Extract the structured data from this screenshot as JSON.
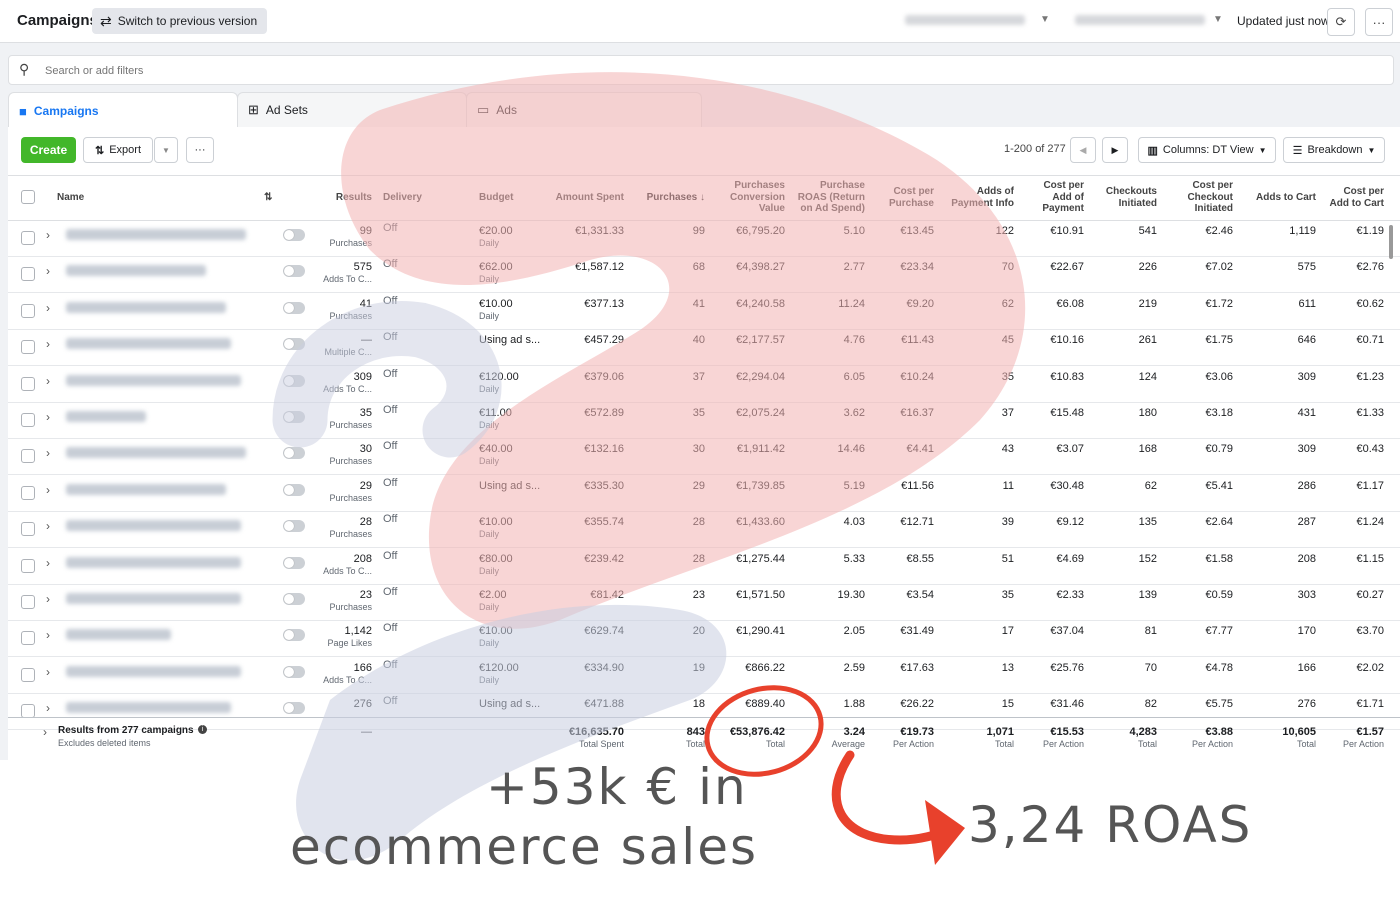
{
  "topbar": {
    "title": "Campaigns",
    "switch_label": "Switch to previous version",
    "updated": "Updated just now"
  },
  "search": {
    "placeholder": "Search or add filters"
  },
  "tabs": [
    {
      "label": "Campaigns"
    },
    {
      "label": "Ad Sets"
    },
    {
      "label": "Ads"
    }
  ],
  "toolbar": {
    "create": "Create",
    "export": "Export",
    "more": "···",
    "pagination": "1-200 of 277",
    "columns": "Columns: DT View",
    "breakdown": "Breakdown"
  },
  "columns": {
    "name": "Name",
    "results": "Results",
    "delivery": "Delivery",
    "budget": "Budget",
    "amount_spent": "Amount Spent",
    "purchases": "Purchases ↓",
    "pcv": "Purchases Conversion Value",
    "roas": "Purchase ROAS (Return on Ad Spend)",
    "cpp": "Cost per Purchase",
    "api": "Adds of Payment Info",
    "capi": "Cost per Add of Payment",
    "ci": "Checkouts Initiated",
    "cpci": "Cost per Checkout Initiated",
    "atc": "Adds to Cart",
    "catc": "Cost per Add to Cart"
  },
  "rows": [
    {
      "results": "99",
      "result_type": "Purchases",
      "delivery": "Off",
      "budget": "€20.00",
      "budget_type": "Daily",
      "spent": "€1,331.33",
      "purchases": "99",
      "pcv": "€6,795.20",
      "roas": "5.10",
      "cpp": "€13.45",
      "api": "122",
      "capi": "€10.91",
      "ci": "541",
      "cpci": "€2.46",
      "atc": "1,119",
      "catc": "€1.19"
    },
    {
      "results": "575",
      "result_type": "Adds To C...",
      "delivery": "Off",
      "budget": "€62.00",
      "budget_type": "Daily",
      "spent": "€1,587.12",
      "purchases": "68",
      "pcv": "€4,398.27",
      "roas": "2.77",
      "cpp": "€23.34",
      "api": "70",
      "capi": "€22.67",
      "ci": "226",
      "cpci": "€7.02",
      "atc": "575",
      "catc": "€2.76"
    },
    {
      "results": "41",
      "result_type": "Purchases",
      "delivery": "Off",
      "budget": "€10.00",
      "budget_type": "Daily",
      "spent": "€377.13",
      "purchases": "41",
      "pcv": "€4,240.58",
      "roas": "11.24",
      "cpp": "€9.20",
      "api": "62",
      "capi": "€6.08",
      "ci": "219",
      "cpci": "€1.72",
      "atc": "611",
      "catc": "€0.62"
    },
    {
      "results": "—",
      "result_type": "Multiple C...",
      "delivery": "Off",
      "budget": "Using ad s...",
      "budget_type": "",
      "spent": "€457.29",
      "purchases": "40",
      "pcv": "€2,177.57",
      "roas": "4.76",
      "cpp": "€11.43",
      "api": "45",
      "capi": "€10.16",
      "ci": "261",
      "cpci": "€1.75",
      "atc": "646",
      "catc": "€0.71"
    },
    {
      "results": "309",
      "result_type": "Adds To C...",
      "delivery": "Off",
      "budget": "€120.00",
      "budget_type": "Daily",
      "spent": "€379.06",
      "purchases": "37",
      "pcv": "€2,294.04",
      "roas": "6.05",
      "cpp": "€10.24",
      "api": "35",
      "capi": "€10.83",
      "ci": "124",
      "cpci": "€3.06",
      "atc": "309",
      "catc": "€1.23"
    },
    {
      "results": "35",
      "result_type": "Purchases",
      "delivery": "Off",
      "budget": "€11.00",
      "budget_type": "Daily",
      "spent": "€572.89",
      "purchases": "35",
      "pcv": "€2,075.24",
      "roas": "3.62",
      "cpp": "€16.37",
      "api": "37",
      "capi": "€15.48",
      "ci": "180",
      "cpci": "€3.18",
      "atc": "431",
      "catc": "€1.33"
    },
    {
      "results": "30",
      "result_type": "Purchases",
      "delivery": "Off",
      "budget": "€40.00",
      "budget_type": "Daily",
      "spent": "€132.16",
      "purchases": "30",
      "pcv": "€1,911.42",
      "roas": "14.46",
      "cpp": "€4.41",
      "api": "43",
      "capi": "€3.07",
      "ci": "168",
      "cpci": "€0.79",
      "atc": "309",
      "catc": "€0.43"
    },
    {
      "results": "29",
      "result_type": "Purchases",
      "delivery": "Off",
      "budget": "Using ad s...",
      "budget_type": "",
      "spent": "€335.30",
      "purchases": "29",
      "pcv": "€1,739.85",
      "roas": "5.19",
      "cpp": "€11.56",
      "api": "11",
      "capi": "€30.48",
      "ci": "62",
      "cpci": "€5.41",
      "atc": "286",
      "catc": "€1.17"
    },
    {
      "results": "28",
      "result_type": "Purchases",
      "delivery": "Off",
      "budget": "€10.00",
      "budget_type": "Daily",
      "spent": "€355.74",
      "purchases": "28",
      "pcv": "€1,433.60",
      "roas": "4.03",
      "cpp": "€12.71",
      "api": "39",
      "capi": "€9.12",
      "ci": "135",
      "cpci": "€2.64",
      "atc": "287",
      "catc": "€1.24"
    },
    {
      "results": "208",
      "result_type": "Adds To C...",
      "delivery": "Off",
      "budget": "€80.00",
      "budget_type": "Daily",
      "spent": "€239.42",
      "purchases": "28",
      "pcv": "€1,275.44",
      "roas": "5.33",
      "cpp": "€8.55",
      "api": "51",
      "capi": "€4.69",
      "ci": "152",
      "cpci": "€1.58",
      "atc": "208",
      "catc": "€1.15"
    },
    {
      "results": "23",
      "result_type": "Purchases",
      "delivery": "Off",
      "budget": "€2.00",
      "budget_type": "Daily",
      "spent": "€81.42",
      "purchases": "23",
      "pcv": "€1,571.50",
      "roas": "19.30",
      "cpp": "€3.54",
      "api": "35",
      "capi": "€2.33",
      "ci": "139",
      "cpci": "€0.59",
      "atc": "303",
      "catc": "€0.27"
    },
    {
      "results": "1,142",
      "result_type": "Page Likes",
      "delivery": "Off",
      "budget": "€10.00",
      "budget_type": "Daily",
      "spent": "€629.74",
      "purchases": "20",
      "pcv": "€1,290.41",
      "roas": "2.05",
      "cpp": "€31.49",
      "api": "17",
      "capi": "€37.04",
      "ci": "81",
      "cpci": "€7.77",
      "atc": "170",
      "catc": "€3.70"
    },
    {
      "results": "166",
      "result_type": "Adds To C...",
      "delivery": "Off",
      "budget": "€120.00",
      "budget_type": "Daily",
      "spent": "€334.90",
      "purchases": "19",
      "pcv": "€866.22",
      "roas": "2.59",
      "cpp": "€17.63",
      "api": "13",
      "capi": "€25.76",
      "ci": "70",
      "cpci": "€4.78",
      "atc": "166",
      "catc": "€2.02"
    },
    {
      "results": "276",
      "result_type": "",
      "delivery": "Off",
      "budget": "Using ad s...",
      "budget_type": "",
      "spent": "€471.88",
      "purchases": "18",
      "pcv": "€889.40",
      "roas": "1.88",
      "cpp": "€26.22",
      "api": "15",
      "capi": "€31.46",
      "ci": "82",
      "cpci": "€5.75",
      "atc": "276",
      "catc": "€1.71"
    }
  ],
  "totals": {
    "label": "Results from 277 campaigns",
    "sub": "Excludes deleted items",
    "results": "—",
    "spent": "€16,635.70",
    "spent_l": "Total Spent",
    "purchases": "843",
    "purchases_l": "Total",
    "pcv": "€53,876.42",
    "pcv_l": "Total",
    "roas": "3.24",
    "roas_l": "Average",
    "cpp": "€19.73",
    "cpp_l": "Per Action",
    "api": "1,071",
    "api_l": "Total",
    "capi": "€15.53",
    "capi_l": "Per Action",
    "ci": "4,283",
    "ci_l": "Total",
    "cpci": "€3.88",
    "cpci_l": "Per Action",
    "atc": "10,605",
    "atc_l": "Total",
    "catc": "€1.57",
    "catc_l": "Per Action"
  },
  "annotations": {
    "sales_line1": "+53k € in",
    "sales_line2": "ecommerce sales",
    "roas": "3,24 ROAS"
  },
  "colors": {
    "accent": "#1877f2",
    "create": "#42b72a",
    "annotation_red": "#e8412c",
    "watermark_red": "#f3b2b2",
    "watermark_blue": "#c9cde0"
  }
}
